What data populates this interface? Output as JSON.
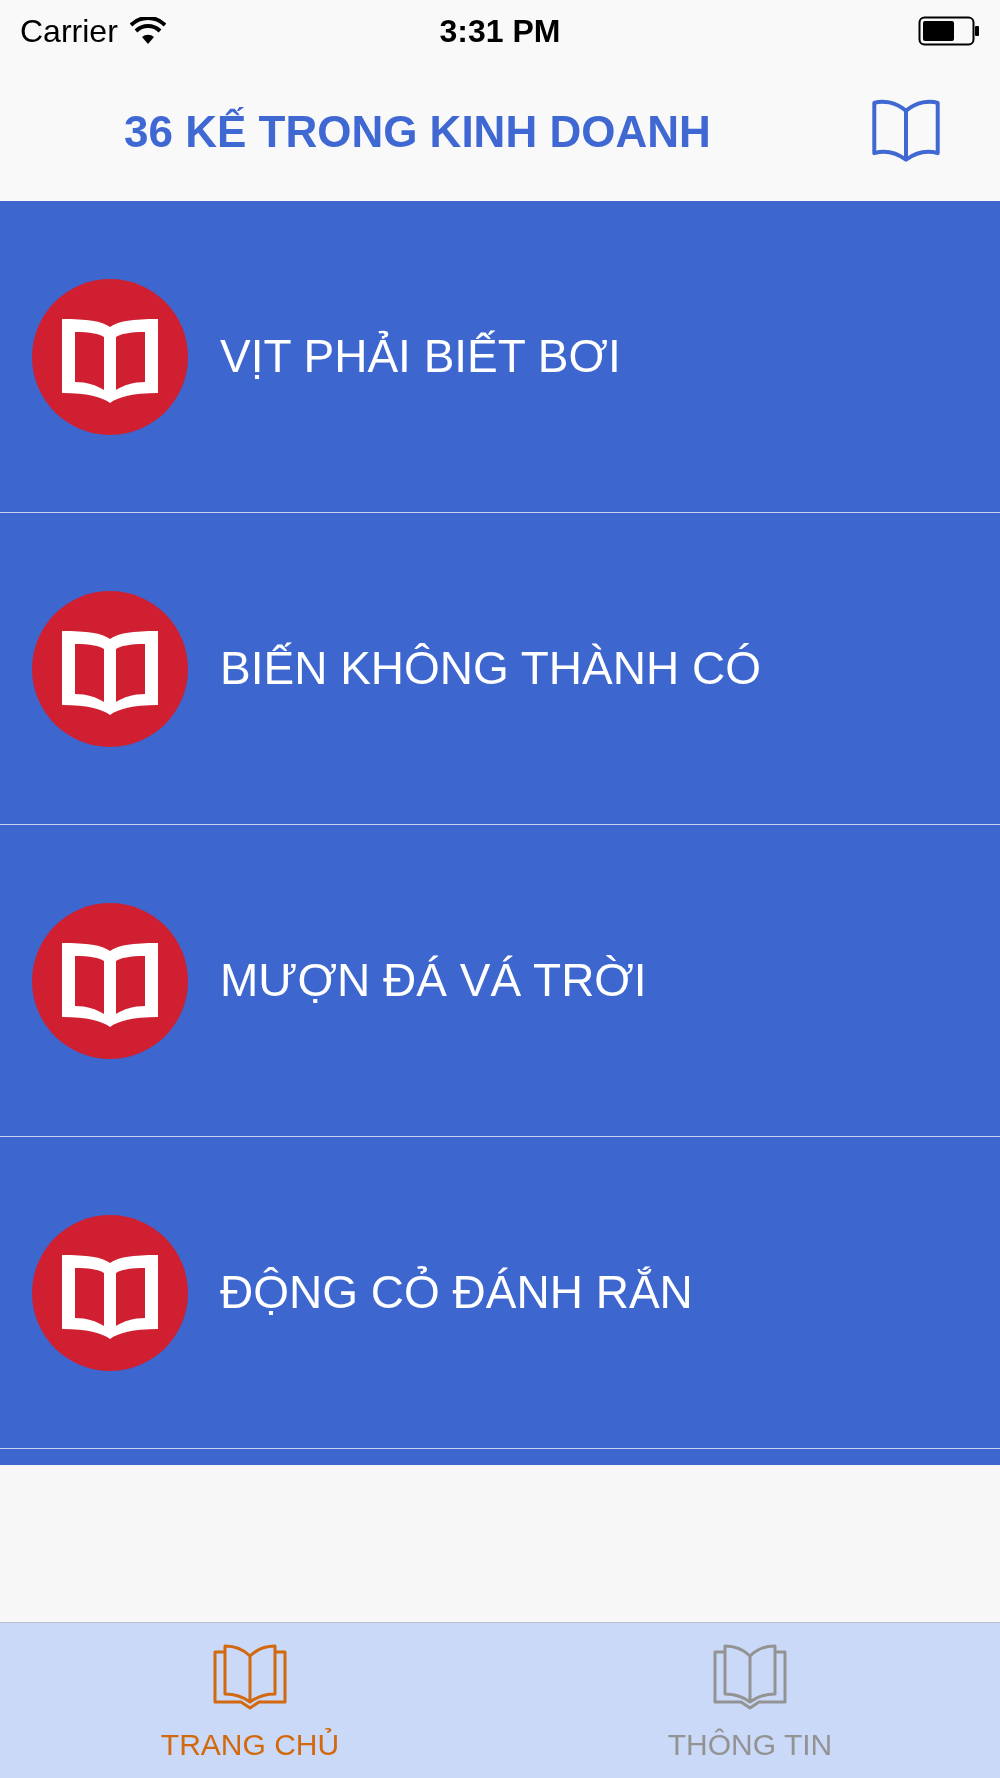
{
  "status_bar": {
    "carrier": "Carrier",
    "time": "3:31 PM"
  },
  "header": {
    "title": "36 KẾ TRONG KINH DOANH"
  },
  "items": [
    {
      "title": "VỊT PHẢI BIẾT BƠI"
    },
    {
      "title": "BIẾN KHÔNG THÀNH CÓ"
    },
    {
      "title": "MƯỢN ĐÁ VÁ TRỜI"
    },
    {
      "title": "ĐỘNG CỎ ĐÁNH RẮN"
    }
  ],
  "tabs": [
    {
      "label": "TRANG CHỦ",
      "selected": true
    },
    {
      "label": "THÔNG TIN",
      "selected": false
    }
  ]
}
